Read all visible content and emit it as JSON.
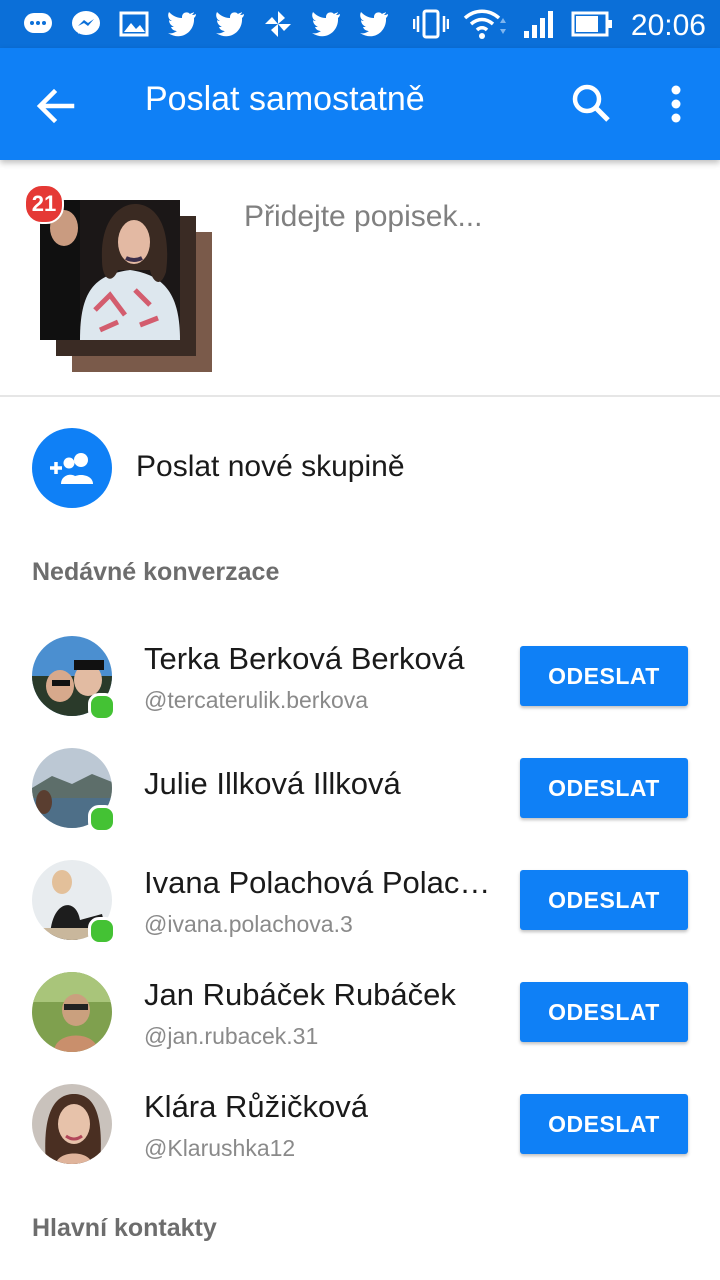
{
  "status_bar": {
    "time": "20:06",
    "left_icons": [
      "chat-bubble-icon",
      "messenger-icon",
      "gallery-icon",
      "twitter-icon",
      "twitter-icon",
      "pinwheel-icon",
      "twitter-icon",
      "twitter-icon"
    ],
    "right_icons": [
      "vibrate-icon",
      "wifi-icon",
      "signal-icon",
      "battery-icon"
    ]
  },
  "app_bar": {
    "title": "Poslat samostatně",
    "actions": [
      "back-arrow-icon",
      "search-icon",
      "more-vert-icon"
    ]
  },
  "media": {
    "count_badge": "21",
    "caption_placeholder": "Přidejte popisek..."
  },
  "new_group": {
    "label": "Poslat nové skupině",
    "icon": "add-group-icon"
  },
  "sections": {
    "recent": "Nedávné konverzace",
    "main_contacts": "Hlavní kontakty"
  },
  "conversations": [
    {
      "name": "Terka Berková Berková",
      "handle": "@tercaterulik.berkova",
      "online": true,
      "button": "ODESLAT"
    },
    {
      "name": "Julie Illková Illková",
      "handle": "",
      "online": true,
      "button": "ODESLAT"
    },
    {
      "name": "Ivana Polachová Polac…",
      "handle": "@ivana.polachova.3",
      "online": true,
      "button": "ODESLAT"
    },
    {
      "name": "Jan Rubáček Rubáček",
      "handle": "@jan.rubacek.31",
      "online": false,
      "button": "ODESLAT"
    },
    {
      "name": "Klára Růžičková",
      "handle": "@Klarushka12",
      "online": false,
      "button": "ODESLAT"
    }
  ],
  "colors": {
    "status_bar": "#0b6fd8",
    "app_bar": "#0f80f6",
    "accent": "#0f80f6",
    "online": "#44c234",
    "badge": "#e53935"
  }
}
